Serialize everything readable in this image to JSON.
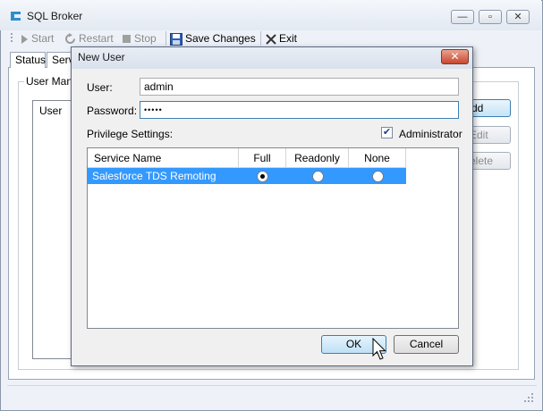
{
  "app": {
    "title": "SQL Broker",
    "window_controls": {
      "minimize": "—",
      "maximize": "▫",
      "close": "✕"
    }
  },
  "toolbar": {
    "start_label": "Start",
    "restart_label": "Restart",
    "stop_label": "Stop",
    "save_label": "Save Changes",
    "exit_label": "Exit"
  },
  "tabs": [
    {
      "label": "Status"
    },
    {
      "label": "Serv"
    }
  ],
  "user_management": {
    "group_label": "User Mana",
    "list_header": "User",
    "buttons": {
      "add": "dd",
      "edit": "Edit",
      "delete": "elete"
    }
  },
  "dialog": {
    "title": "New User",
    "close_glyph": "✕",
    "user_label": "User:",
    "user_value": "admin",
    "password_label": "Password:",
    "password_value": "•••••",
    "privilege_label": "Privilege Settings:",
    "administrator_label": "Administrator",
    "administrator_checked": true,
    "grid": {
      "columns": [
        "Service Name",
        "Full",
        "Readonly",
        "None"
      ],
      "rows": [
        {
          "service": "Salesforce TDS Remoting",
          "selected": "Full"
        }
      ]
    },
    "ok_label": "OK",
    "cancel_label": "Cancel"
  },
  "colors": {
    "selection": "#3399ff",
    "close_button": "#c9482f"
  },
  "icons": [
    "app-icon",
    "start-icon",
    "restart-icon",
    "stop-icon",
    "save-icon",
    "exit-icon",
    "check-icon",
    "size-grip-icon",
    "mouse-cursor-icon"
  ]
}
